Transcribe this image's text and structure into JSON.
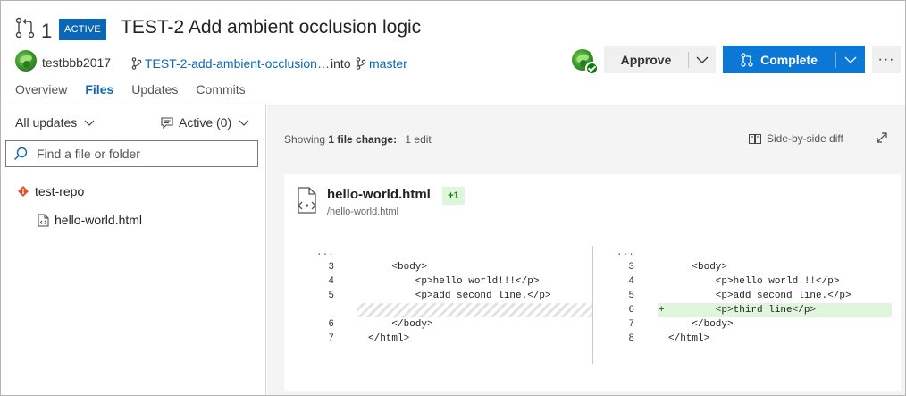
{
  "pr": {
    "id": "1",
    "status": "ACTIVE",
    "title": "TEST-2 Add ambient occlusion logic",
    "author": "testbbb2017",
    "source_branch": "TEST-2-add-ambient-occlusion…",
    "into_label": "into",
    "target_branch": "master"
  },
  "actions": {
    "approve_label": "Approve",
    "complete_label": "Complete",
    "more_label": "···"
  },
  "tabs": [
    {
      "label": "Overview"
    },
    {
      "label": "Files"
    },
    {
      "label": "Updates"
    },
    {
      "label": "Commits"
    }
  ],
  "sidebar": {
    "updates_filter": "All updates",
    "comments_filter": "Active (0)",
    "search_placeholder": "Find a file or folder",
    "repo": "test-repo",
    "file": "hello-world.html"
  },
  "diff_toolbar": {
    "showing_prefix": "Showing",
    "showing_count": "1 file change:",
    "edits": "1 edit",
    "view_mode": "Side-by-side diff"
  },
  "file": {
    "name": "hello-world.html",
    "change_count": "+1",
    "path": "/hello-world.html"
  },
  "diff": {
    "ellipsis": "...",
    "left": [
      {
        "ln": "3",
        "code": "    <body>"
      },
      {
        "ln": "4",
        "code": "        <p>hello world!!!</p>"
      },
      {
        "ln": "5",
        "code": "        <p>add second line.</p>"
      },
      {
        "ln": "6",
        "code": "    </body>"
      },
      {
        "ln": "7",
        "code": "</html>"
      }
    ],
    "right": [
      {
        "ln": "3",
        "code": "    <body>"
      },
      {
        "ln": "4",
        "code": "        <p>hello world!!!</p>"
      },
      {
        "ln": "5",
        "code": "        <p>add second line.</p>"
      },
      {
        "ln": "6",
        "code": "        <p>third line</p>"
      },
      {
        "ln": "7",
        "code": "    </body>"
      },
      {
        "ln": "8",
        "code": "</html>"
      }
    ],
    "added_marker": "+"
  },
  "colors": {
    "accent": "#0a78d4",
    "badge": "#0a66b7",
    "added_bg": "#dff6dd",
    "approved_check": "#107c10"
  }
}
